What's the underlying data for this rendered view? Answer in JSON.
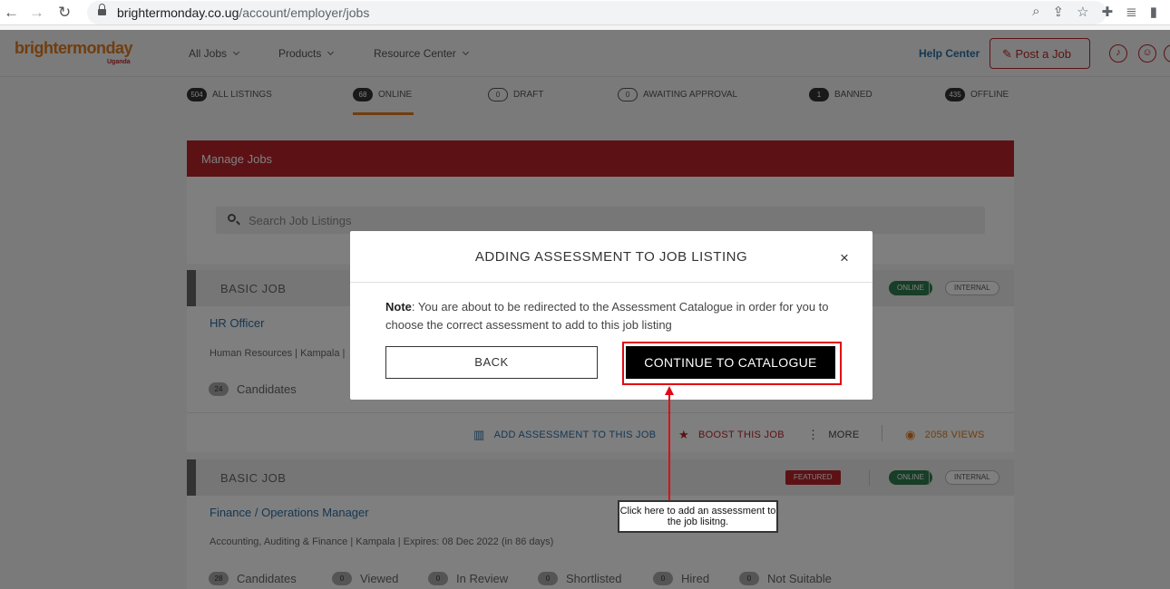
{
  "browser": {
    "url_host": "brightermonday.co.ug",
    "url_path": "/account/employer/jobs"
  },
  "header": {
    "logo_text": "brightermonday",
    "logo_sub": "Uganda",
    "nav": [
      "All Jobs",
      "Products",
      "Resource Center"
    ],
    "help_center": "Help Center",
    "post_job": "Post a Job"
  },
  "tabs": [
    {
      "count": "504",
      "label": "ALL LISTINGS"
    },
    {
      "count": "68",
      "label": "ONLINE"
    },
    {
      "count": "0",
      "label": "DRAFT"
    },
    {
      "count": "0",
      "label": "AWAITING APPROVAL"
    },
    {
      "count": "1",
      "label": "BANNED"
    },
    {
      "count": "435",
      "label": "OFFLINE"
    }
  ],
  "manage": {
    "title": "Manage Jobs",
    "search_placeholder": "Search Job Listings"
  },
  "jobs": [
    {
      "type": "BASIC JOB",
      "title": "HR Officer",
      "meta": "Human Resources | Kampala |",
      "status": "ONLINE",
      "visibility": "INTERNAL",
      "candidates_count": "24",
      "candidates_label": "Candidates",
      "actions": {
        "add_assessment": "ADD ASSESSMENT TO THIS JOB",
        "boost": "BOOST THIS JOB",
        "more": "MORE",
        "views": "2058 VIEWS"
      }
    },
    {
      "type": "BASIC JOB",
      "title": "Finance / Operations Manager",
      "meta": "Accounting, Auditing & Finance | Kampala | Expires: 08 Dec 2022 (in 86 days)",
      "featured": "FEATURED",
      "status": "ONLINE",
      "visibility": "INTERNAL",
      "stats": [
        {
          "count": "28",
          "label": "Candidates"
        },
        {
          "count": "0",
          "label": "Viewed"
        },
        {
          "count": "0",
          "label": "In Review"
        },
        {
          "count": "0",
          "label": "Shortlisted"
        },
        {
          "count": "0",
          "label": "Hired"
        },
        {
          "count": "0",
          "label": "Not Suitable"
        }
      ]
    }
  ],
  "modal": {
    "title": "ADDING ASSESSMENT TO JOB LISTING",
    "close": "×",
    "note_label": "Note",
    "note_text": ": You are about to be redirected to the Assessment Catalogue in order for you to choose the correct assessment to add to this job listing",
    "back": "BACK",
    "continue": "CONTINUE TO CATALOGUE"
  },
  "annotation": {
    "callout": "Click here to add an assessment to the job lisitng.",
    "highlight_color": "#e30613"
  },
  "colors": {
    "brand_red": "#b8242b",
    "brand_orange": "#e07b1e",
    "link_blue": "#2c6fa5",
    "online_green": "#2e7d4f"
  }
}
